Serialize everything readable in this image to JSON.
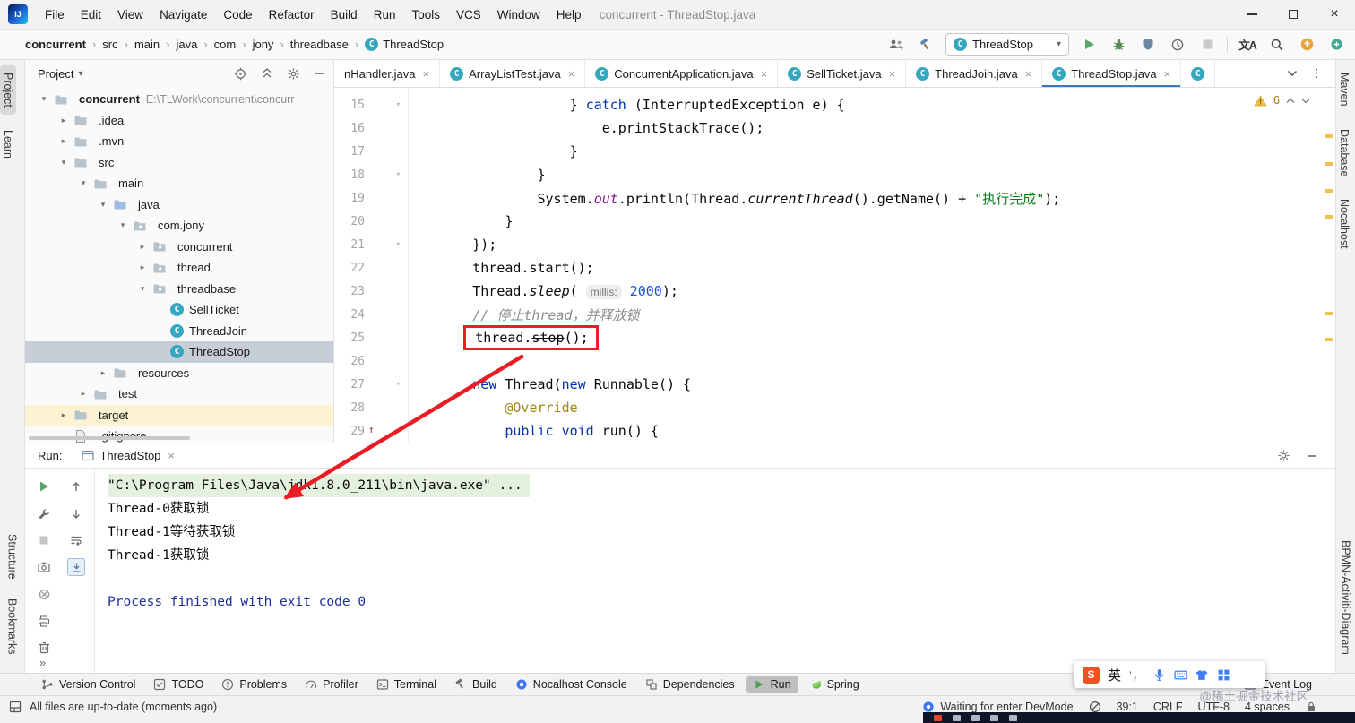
{
  "titlebar": {
    "title": "concurrent - ThreadStop.java",
    "menu": [
      "File",
      "Edit",
      "View",
      "Navigate",
      "Code",
      "Refactor",
      "Build",
      "Run",
      "Tools",
      "VCS",
      "Window",
      "Help"
    ]
  },
  "navbar": {
    "breadcrumbs": [
      "concurrent",
      "src",
      "main",
      "java",
      "com",
      "jony",
      "threadbase"
    ],
    "breadcrumb_leaf": "ThreadStop",
    "run_config": "ThreadStop",
    "translate_glyph": "文A"
  },
  "tool_strips": {
    "left_top": [
      "Project",
      "Learn"
    ],
    "left_bottom": [
      "Structure",
      "Bookmarks"
    ],
    "right_top": [
      "Maven",
      "Database",
      "Nocalhost"
    ],
    "right_bottom": [
      "BPMN-Activiti-Diagram"
    ]
  },
  "project_panel": {
    "title": "Project",
    "tree": [
      {
        "label": "concurrent",
        "path": "E:\\TLWork\\concurrent\\concurr",
        "level": 0,
        "chevron": "down",
        "icon": "folder",
        "bold": true
      },
      {
        "label": ".idea",
        "level": 1,
        "chevron": "right",
        "icon": "folder"
      },
      {
        "label": ".mvn",
        "level": 1,
        "chevron": "right",
        "icon": "folder"
      },
      {
        "label": "src",
        "level": 1,
        "chevron": "down",
        "icon": "folder"
      },
      {
        "label": "main",
        "level": 2,
        "chevron": "down",
        "icon": "folder"
      },
      {
        "label": "java",
        "level": 3,
        "chevron": "down",
        "icon": "srcfolder"
      },
      {
        "label": "com.jony",
        "level": 4,
        "chevron": "down",
        "icon": "package"
      },
      {
        "label": "concurrent",
        "level": 5,
        "chevron": "right",
        "icon": "package"
      },
      {
        "label": "thread",
        "level": 5,
        "chevron": "right",
        "icon": "package"
      },
      {
        "label": "threadbase",
        "level": 5,
        "chevron": "down",
        "icon": "package"
      },
      {
        "label": "SellTicket",
        "level": 6,
        "icon": "class"
      },
      {
        "label": "ThreadJoin",
        "level": 6,
        "icon": "class"
      },
      {
        "label": "ThreadStop",
        "level": 6,
        "icon": "class",
        "selected": true
      },
      {
        "label": "resources",
        "level": 3,
        "chevron": "right",
        "icon": "folder"
      },
      {
        "label": "test",
        "level": 2,
        "chevron": "right",
        "icon": "folder"
      },
      {
        "label": "target",
        "level": 1,
        "chevron": "right",
        "icon": "folder",
        "highlight": true
      },
      {
        "label": ".gitignore",
        "level": 1,
        "icon": "file"
      }
    ]
  },
  "editor": {
    "tabs": [
      {
        "label": "nHandler.java",
        "icon": false
      },
      {
        "label": "ArrayListTest.java",
        "icon": true
      },
      {
        "label": "ConcurrentApplication.java",
        "icon": true
      },
      {
        "label": "SellTicket.java",
        "icon": true
      },
      {
        "label": "ThreadJoin.java",
        "icon": true
      },
      {
        "label": "ThreadStop.java",
        "icon": true,
        "active": true
      },
      {
        "label": "",
        "icon": true,
        "stub": true
      }
    ],
    "warning_count": "6",
    "code": [
      {
        "num": "15",
        "fold": true,
        "segs": [
          [
            "p",
            "                    } "
          ],
          [
            "k",
            "catch"
          ],
          [
            "p",
            " (InterruptedException e) {"
          ]
        ]
      },
      {
        "num": "16",
        "segs": [
          [
            "p",
            "                        e.printStackTrace();"
          ]
        ]
      },
      {
        "num": "17",
        "segs": [
          [
            "p",
            "                    }"
          ]
        ]
      },
      {
        "num": "18",
        "fold": true,
        "segs": [
          [
            "p",
            "                }"
          ]
        ]
      },
      {
        "num": "19",
        "segs": [
          [
            "p",
            "                System."
          ],
          [
            "sf",
            "out"
          ],
          [
            "p",
            ".println(Thread."
          ],
          [
            "sm",
            "currentThread"
          ],
          [
            "p",
            "().getName() + "
          ],
          [
            "s",
            "\"执行完成\""
          ],
          [
            "p",
            ");"
          ]
        ]
      },
      {
        "num": "20",
        "segs": [
          [
            "p",
            "            }"
          ]
        ]
      },
      {
        "num": "21",
        "fold": true,
        "segs": [
          [
            "p",
            "        });"
          ]
        ]
      },
      {
        "num": "22",
        "segs": [
          [
            "p",
            "        thread.start();"
          ]
        ]
      },
      {
        "num": "23",
        "segs": [
          [
            "p",
            "        Thread."
          ],
          [
            "sm",
            "sleep"
          ],
          [
            "p",
            "( "
          ],
          [
            "h",
            "millis:"
          ],
          [
            "p",
            " "
          ],
          [
            "n",
            "2000"
          ],
          [
            "p",
            ");"
          ]
        ]
      },
      {
        "num": "24",
        "segs": [
          [
            "c",
            "        // 停止thread，并释放锁"
          ]
        ]
      },
      {
        "num": "25",
        "pre": "        ",
        "box": [
          [
            "p",
            "thread."
          ],
          [
            "d",
            "stop"
          ],
          [
            "p",
            "();"
          ]
        ]
      },
      {
        "num": "26",
        "segs": []
      },
      {
        "num": "27",
        "fold": true,
        "segs": [
          [
            "p",
            "        "
          ],
          [
            "k",
            "new"
          ],
          [
            "p",
            " Thread("
          ],
          [
            "k",
            "new"
          ],
          [
            "p",
            " Runnable() {"
          ]
        ]
      },
      {
        "num": "28",
        "segs": [
          [
            "p",
            "            "
          ],
          [
            "a",
            "@Override"
          ]
        ]
      },
      {
        "num": "29",
        "gutter": "override",
        "segs": [
          [
            "p",
            "            "
          ],
          [
            "k",
            "public"
          ],
          [
            "p",
            " "
          ],
          [
            "k",
            "void"
          ],
          [
            "p",
            " run() {"
          ]
        ]
      }
    ]
  },
  "run_panel": {
    "label": "Run:",
    "tab": "ThreadStop",
    "console": [
      {
        "text": "\"C:\\Program Files\\Java\\jdk1.8.0_211\\bin\\java.exe\" ...",
        "highlight": true
      },
      {
        "text": "Thread-0获取锁"
      },
      {
        "text": "Thread-1等待获取锁"
      },
      {
        "text": "Thread-1获取锁"
      },
      {
        "text": ""
      },
      {
        "text": "Process finished with exit code 0",
        "system": true
      }
    ]
  },
  "toolwindow_bar": {
    "items": [
      {
        "label": "Version Control",
        "icon": "vcs"
      },
      {
        "label": "TODO",
        "icon": "todo"
      },
      {
        "label": "Problems",
        "icon": "problems"
      },
      {
        "label": "Profiler",
        "icon": "profiler"
      },
      {
        "label": "Terminal",
        "icon": "terminal"
      },
      {
        "label": "Build",
        "icon": "build"
      },
      {
        "label": "Nocalhost Console",
        "icon": "nocalhost"
      },
      {
        "label": "Dependencies",
        "icon": "dependencies"
      },
      {
        "label": "Run",
        "icon": "run",
        "active": true
      },
      {
        "label": "Spring",
        "icon": "spring"
      }
    ],
    "event_log": "Event Log"
  },
  "status_bar": {
    "left": "All files are up-to-date (moments ago)",
    "devmode": "Waiting for enter DevMode",
    "caret": "39:1",
    "line_ending": "CRLF",
    "encoding": "UTF-8",
    "indent": "4 spaces"
  },
  "ime": {
    "mode": "英",
    "punct": "’，"
  },
  "watermark": "@稀土掘金技术社区"
}
